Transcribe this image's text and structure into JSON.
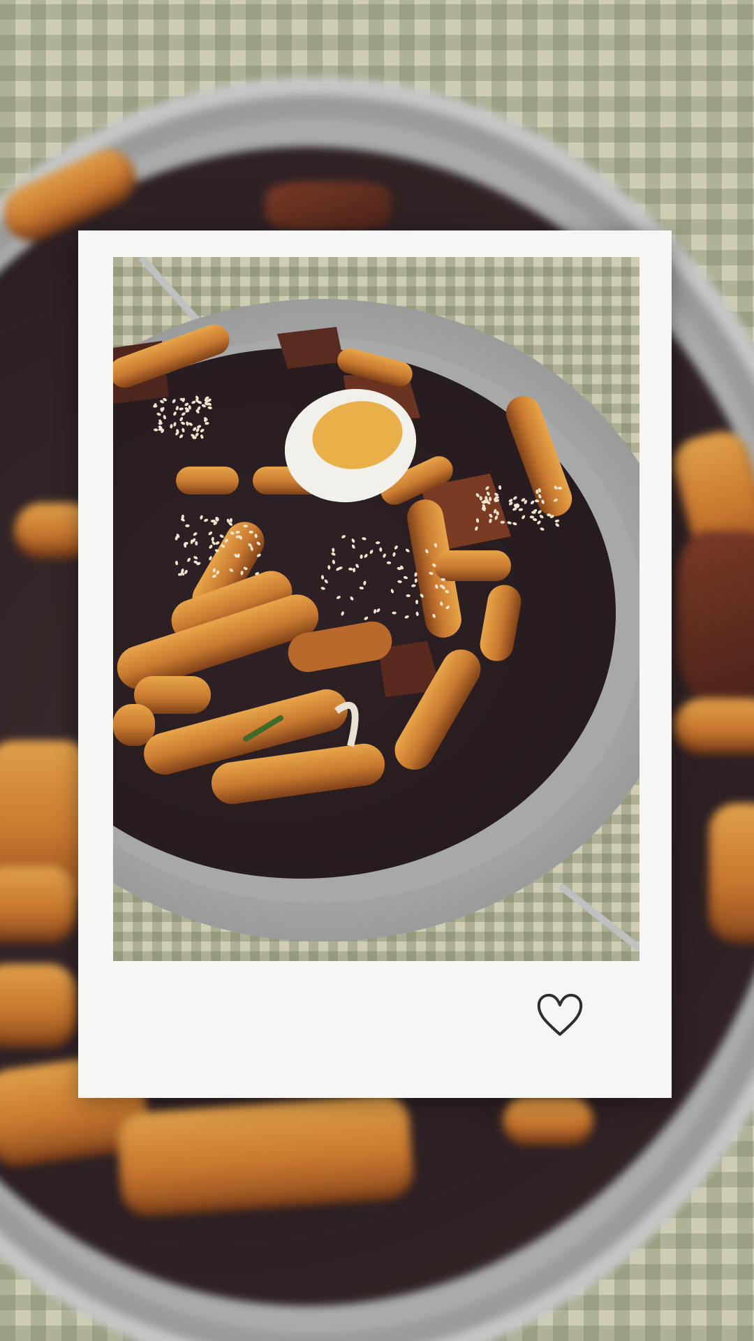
{
  "scene": {
    "subject": "tteokbokki-in-pan",
    "colors": {
      "frame": "#f6f6f4",
      "sauce": "#2c1f22",
      "rice_cake": "#d08a3a",
      "pan": "#b8b9b8",
      "tablecloth": "#cfceb5",
      "egg_yolk": "#e9b04a"
    }
  },
  "icons": {
    "frame_icon": "heart-icon"
  }
}
